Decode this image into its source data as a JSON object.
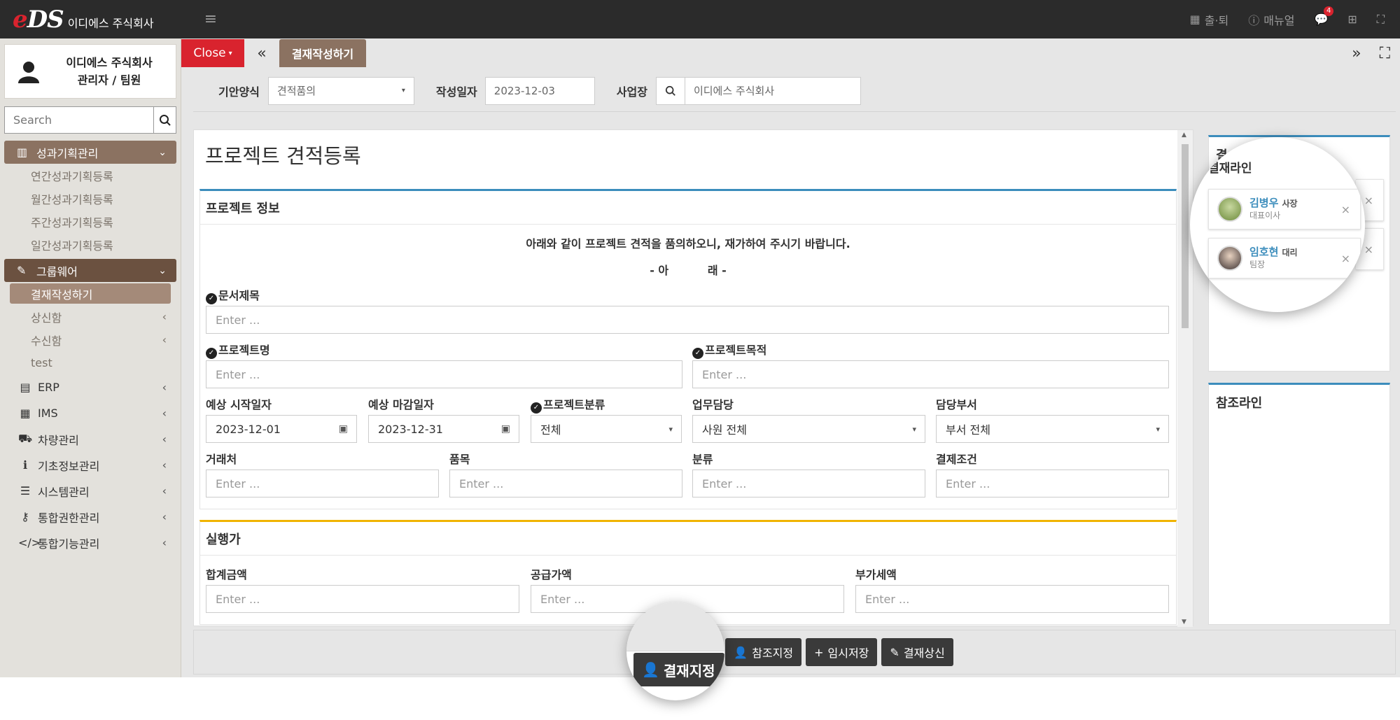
{
  "topbar": {
    "logo_e": "e",
    "logo_ds": "DS",
    "company": "이디에스 주식회사",
    "checkout": "출·퇴",
    "manual": "매뉴얼",
    "notifications": "4"
  },
  "sidebar": {
    "profile_company": "이디에스 주식회사",
    "profile_role": "관리자 / 팀원",
    "search_placeholder": "Search",
    "groups": [
      {
        "label": "성과기획관리",
        "subs": [
          "연간성과기획등록",
          "월간성과기획등록",
          "주간성과기획등록",
          "일간성과기획등록"
        ]
      },
      {
        "label": "그룹웨어",
        "subs": [
          "결재작성하기",
          "상신함",
          "수신함",
          "test"
        ]
      }
    ],
    "items": [
      "ERP",
      "IMS",
      "차량관리",
      "기초정보관리",
      "시스템관리",
      "통합권한관리",
      "통합기능관리"
    ]
  },
  "tabbar": {
    "close": "Close",
    "active_tab": "결재작성하기"
  },
  "filter": {
    "form_label": "기안양식",
    "form_value": "견적품의",
    "date_label": "작성일자",
    "date_value": "2023-12-03",
    "site_label": "사업장",
    "site_value": "이디에스 주식회사"
  },
  "main": {
    "title": "프로젝트 견적등록",
    "project_info": {
      "heading": "프로젝트 정보",
      "intro": "아래와 같이 프로젝트 견적을 품의하오니, 재가하여 주시기 바랍니다.",
      "below": "- 아          래 -",
      "doc_title_label": "문서제목",
      "project_name_label": "프로젝트명",
      "project_purpose_label": "프로젝트목적",
      "start_label": "예상 시작일자",
      "start_value": "2023-12-01",
      "end_label": "예상 마감일자",
      "end_value": "2023-12-31",
      "category_label": "프로젝트분류",
      "category_value": "전체",
      "manager_label": "업무담당",
      "manager_value": "사원 전체",
      "dept_label": "담당부서",
      "dept_value": "부서 전체",
      "client_label": "거래처",
      "item_label": "품목",
      "class_label": "분류",
      "payment_label": "결제조건",
      "placeholder": "Enter ..."
    },
    "execution": {
      "heading": "실행가",
      "total_label": "합계금액",
      "supply_label": "공급가액",
      "vat_label": "부가세액",
      "placeholder": "Enter ..."
    }
  },
  "right": {
    "approval_heading": "결재라인",
    "approval_partial": "결",
    "approvers": [
      {
        "name": "김병우",
        "title": "사장",
        "dept": "대표이사"
      },
      {
        "name": "임호현",
        "title": "대리",
        "dept": "팀장"
      }
    ],
    "reference_heading": "참조라인"
  },
  "actions": {
    "approval_assign": "결재지정",
    "reference_assign": "참조지정",
    "temp_save": "임시저장",
    "submit": "결재상신"
  }
}
